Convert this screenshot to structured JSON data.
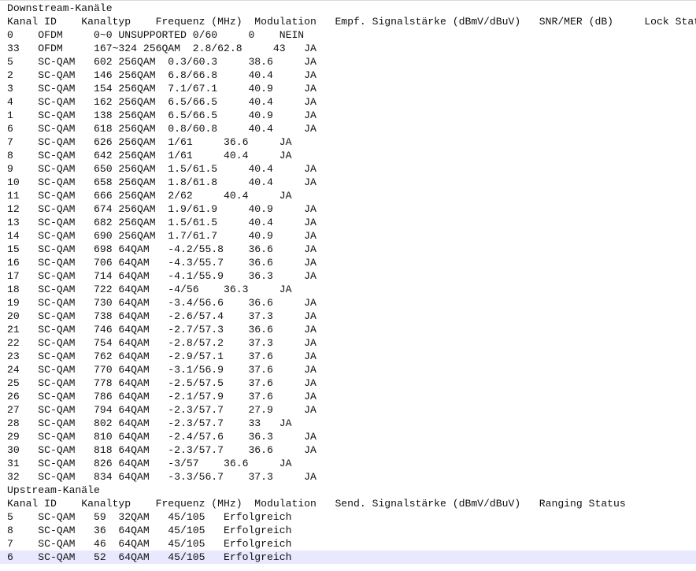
{
  "editor": {
    "current_line": 41,
    "lines": [
      "Downstream-Kanäle",
      "Kanal ID    Kanaltyp    Frequenz (MHz)  Modulation   Empf. Signalstärke (dBmV/dBuV)   SNR/MER (dB)     Lock Status",
      "0    OFDM     0~0 UNSUPPORTED 0/60     0    NEIN",
      "33   OFDM     167~324 256QAM  2.8/62.8     43   JA",
      "5    SC-QAM   602 256QAM  0.3/60.3     38.6     JA",
      "2    SC-QAM   146 256QAM  6.8/66.8     40.4     JA",
      "3    SC-QAM   154 256QAM  7.1/67.1     40.9     JA",
      "4    SC-QAM   162 256QAM  6.5/66.5     40.4     JA",
      "1    SC-QAM   138 256QAM  6.5/66.5     40.9     JA",
      "6    SC-QAM   618 256QAM  0.8/60.8     40.4     JA",
      "7    SC-QAM   626 256QAM  1/61     36.6     JA",
      "8    SC-QAM   642 256QAM  1/61     40.4     JA",
      "9    SC-QAM   650 256QAM  1.5/61.5     40.4     JA",
      "10   SC-QAM   658 256QAM  1.8/61.8     40.4     JA",
      "11   SC-QAM   666 256QAM  2/62     40.4     JA",
      "12   SC-QAM   674 256QAM  1.9/61.9     40.9     JA",
      "13   SC-QAM   682 256QAM  1.5/61.5     40.4     JA",
      "14   SC-QAM   690 256QAM  1.7/61.7     40.9     JA",
      "15   SC-QAM   698 64QAM   -4.2/55.8    36.6     JA",
      "16   SC-QAM   706 64QAM   -4.3/55.7    36.6     JA",
      "17   SC-QAM   714 64QAM   -4.1/55.9    36.3     JA",
      "18   SC-QAM   722 64QAM   -4/56    36.3     JA",
      "19   SC-QAM   730 64QAM   -3.4/56.6    36.6     JA",
      "20   SC-QAM   738 64QAM   -2.6/57.4    37.3     JA",
      "21   SC-QAM   746 64QAM   -2.7/57.3    36.6     JA",
      "22   SC-QAM   754 64QAM   -2.8/57.2    37.3     JA",
      "23   SC-QAM   762 64QAM   -2.9/57.1    37.6     JA",
      "24   SC-QAM   770 64QAM   -3.1/56.9    37.6     JA",
      "25   SC-QAM   778 64QAM   -2.5/57.5    37.6     JA",
      "26   SC-QAM   786 64QAM   -2.1/57.9    37.6     JA",
      "27   SC-QAM   794 64QAM   -2.3/57.7    27.9     JA",
      "28   SC-QAM   802 64QAM   -2.3/57.7    33   JA",
      "29   SC-QAM   810 64QAM   -2.4/57.6    36.3     JA",
      "30   SC-QAM   818 64QAM   -2.3/57.7    36.6     JA",
      "31   SC-QAM   826 64QAM   -3/57    36.6     JA",
      "32   SC-QAM   834 64QAM   -3.3/56.7    37.3     JA",
      "Upstream-Kanäle",
      "Kanal ID    Kanaltyp    Frequenz (MHz)  Modulation   Send. Signalstärke (dBmV/dBuV)   Ranging Status",
      "5    SC-QAM   59  32QAM   45/105   Erfolgreich",
      "8    SC-QAM   36  64QAM   45/105   Erfolgreich",
      "7    SC-QAM   46  64QAM   45/105   Erfolgreich",
      "6    SC-QAM   52  64QAM   45/105   Erfolgreich"
    ]
  }
}
